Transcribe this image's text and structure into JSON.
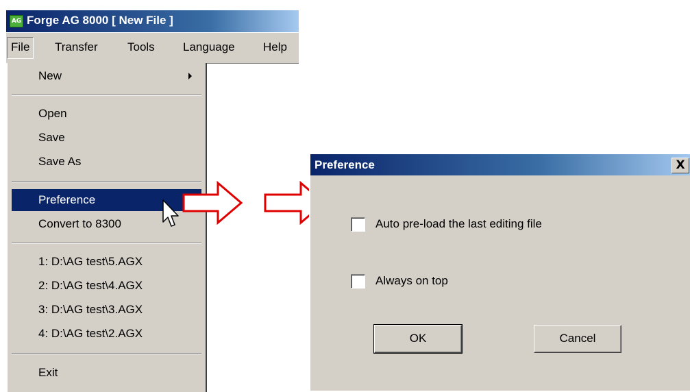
{
  "app": {
    "icon_text": "AG",
    "title": "Forge AG 8000 [ New File ]"
  },
  "menubar": {
    "items": [
      "File",
      "Transfer",
      "Tools",
      "Language",
      "Help"
    ]
  },
  "file_menu": {
    "new": "New",
    "open": "Open",
    "save": "Save",
    "save_as": "Save As",
    "preference": "Preference",
    "convert": "Convert to 8300",
    "recent": [
      "1:  D:\\AG test\\5.AGX",
      "2:  D:\\AG test\\4.AGX",
      "3:  D:\\AG test\\3.AGX",
      "4:  D:\\AG test\\2.AGX"
    ],
    "exit": "Exit"
  },
  "dialog": {
    "title": "Preference",
    "close_symbol": "X",
    "options": [
      "Auto pre-load the last editing file",
      "Always on top"
    ],
    "ok_label": "OK",
    "cancel_label": "Cancel"
  },
  "colors": {
    "titlebar": "#0a246a",
    "highlight": "#0a246a",
    "arrow": "#e00000",
    "window_bg": "#d4d0c8"
  }
}
